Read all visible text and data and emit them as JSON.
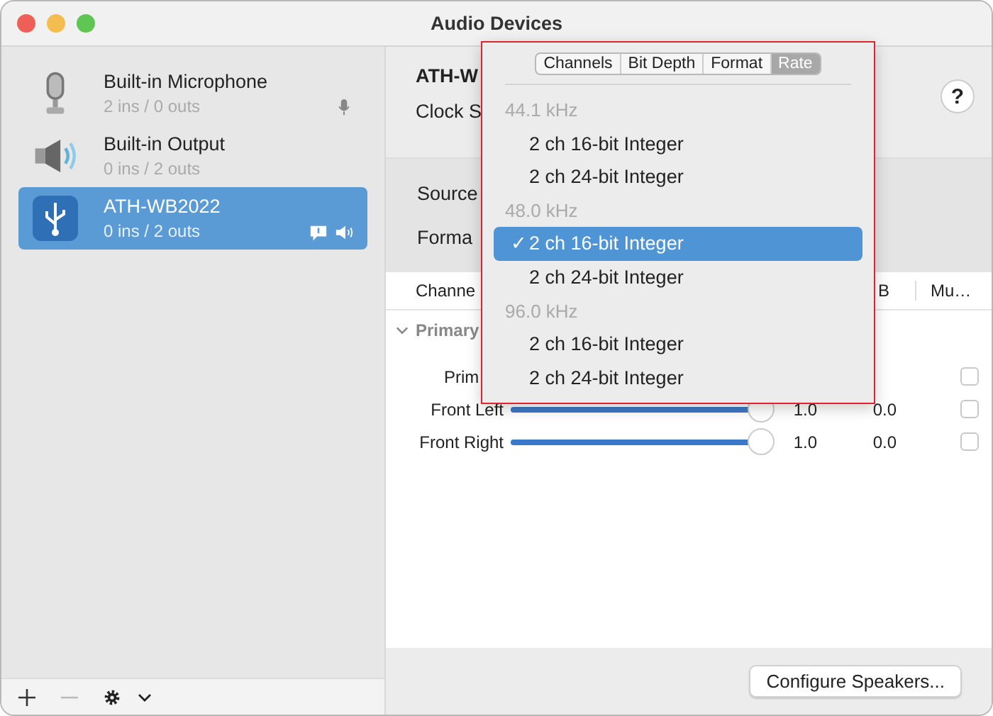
{
  "window": {
    "title": "Audio Devices"
  },
  "sidebar": {
    "devices": [
      {
        "name": "Built-in Microphone",
        "io": "2 ins / 0 outs",
        "kind": "microphone",
        "selected": false,
        "indicators": [
          {
            "kind": "input"
          }
        ]
      },
      {
        "name": "Built-in Output",
        "io": "0 ins / 2 outs",
        "kind": "speaker",
        "selected": false
      },
      {
        "name": "ATH-WB2022",
        "io": "0 ins / 2 outs",
        "kind": "usb",
        "selected": true,
        "indicators": [
          {
            "kind": "alert"
          },
          {
            "kind": "output"
          }
        ]
      }
    ],
    "toolbar": {
      "remove_disabled": true
    }
  },
  "detail": {
    "device_name": "ATH-W",
    "clock_label": "Clock S",
    "help": "?",
    "source_label": "Source",
    "format_label": "Forma",
    "table": {
      "columns": [
        "Channe",
        "B",
        "Mu…"
      ],
      "group": "Primary",
      "rows": [
        {
          "label": "Prim",
          "checked": false
        },
        {
          "label": "Front Left",
          "level": 1,
          "value": "1.0",
          "db": "0.0",
          "checked": false
        },
        {
          "label": "Front Right",
          "level": 1,
          "value": "1.0",
          "db": "0.0",
          "checked": false
        }
      ]
    },
    "button": "Configure Speakers..."
  },
  "popup": {
    "tabs": [
      {
        "label": "Channels",
        "selected": false
      },
      {
        "label": "Bit Depth",
        "selected": false
      },
      {
        "label": "Format",
        "selected": false
      },
      {
        "label": "Rate",
        "selected": true
      }
    ],
    "sections": [
      {
        "header": "44.1 kHz",
        "options": [
          {
            "label": "2 ch 16-bit Integer",
            "selected": false
          },
          {
            "label": "2 ch 24-bit Integer",
            "selected": false
          }
        ]
      },
      {
        "header": "48.0 kHz",
        "options": [
          {
            "label": "2 ch 16-bit Integer",
            "selected": true,
            "mark": "✓"
          },
          {
            "label": "2 ch 24-bit Integer",
            "selected": false
          }
        ]
      },
      {
        "header": "96.0 kHz",
        "options": [
          {
            "label": "2 ch 16-bit Integer",
            "selected": false
          },
          {
            "label": "2 ch 24-bit Integer",
            "selected": false
          }
        ]
      }
    ]
  }
}
